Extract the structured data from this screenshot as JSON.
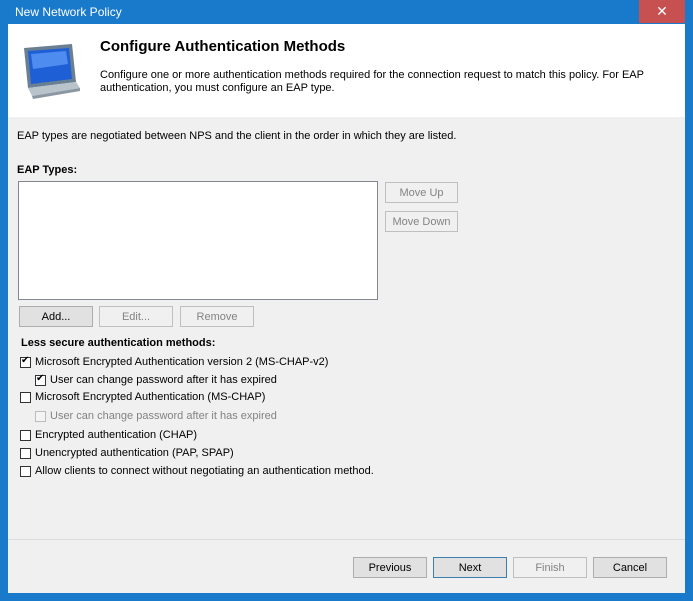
{
  "window": {
    "title": "New Network Policy",
    "close_glyph": "✕"
  },
  "header": {
    "icon": "computer-monitor-icon",
    "title": "Configure Authentication Methods",
    "description": "Configure one or more authentication methods required for the connection request to match this policy. For EAP authentication, you must configure an EAP type."
  },
  "intro": "EAP types are negotiated between NPS and the client in the order in which they are listed.",
  "eap": {
    "label": "EAP Types:",
    "items": [],
    "move_up": "Move Up",
    "move_down": "Move Down",
    "add": "Add...",
    "edit": "Edit...",
    "remove": "Remove"
  },
  "less_secure": {
    "label": "Less secure authentication methods:",
    "options": [
      {
        "label": "Microsoft Encrypted Authentication version 2 (MS-CHAP-v2)",
        "checked": true,
        "enabled": true
      },
      {
        "label": "User can change password after it has expired",
        "checked": true,
        "enabled": true
      },
      {
        "label": "Microsoft Encrypted Authentication (MS-CHAP)",
        "checked": false,
        "enabled": true
      },
      {
        "label": "User can change password after it has expired",
        "checked": false,
        "enabled": false
      },
      {
        "label": "Encrypted authentication (CHAP)",
        "checked": false,
        "enabled": true
      },
      {
        "label": "Unencrypted authentication (PAP, SPAP)",
        "checked": false,
        "enabled": true
      },
      {
        "label": "Allow clients to connect without negotiating an authentication method.",
        "checked": false,
        "enabled": true
      }
    ]
  },
  "footer": {
    "previous": "Previous",
    "next": "Next",
    "finish": "Finish",
    "cancel": "Cancel"
  }
}
